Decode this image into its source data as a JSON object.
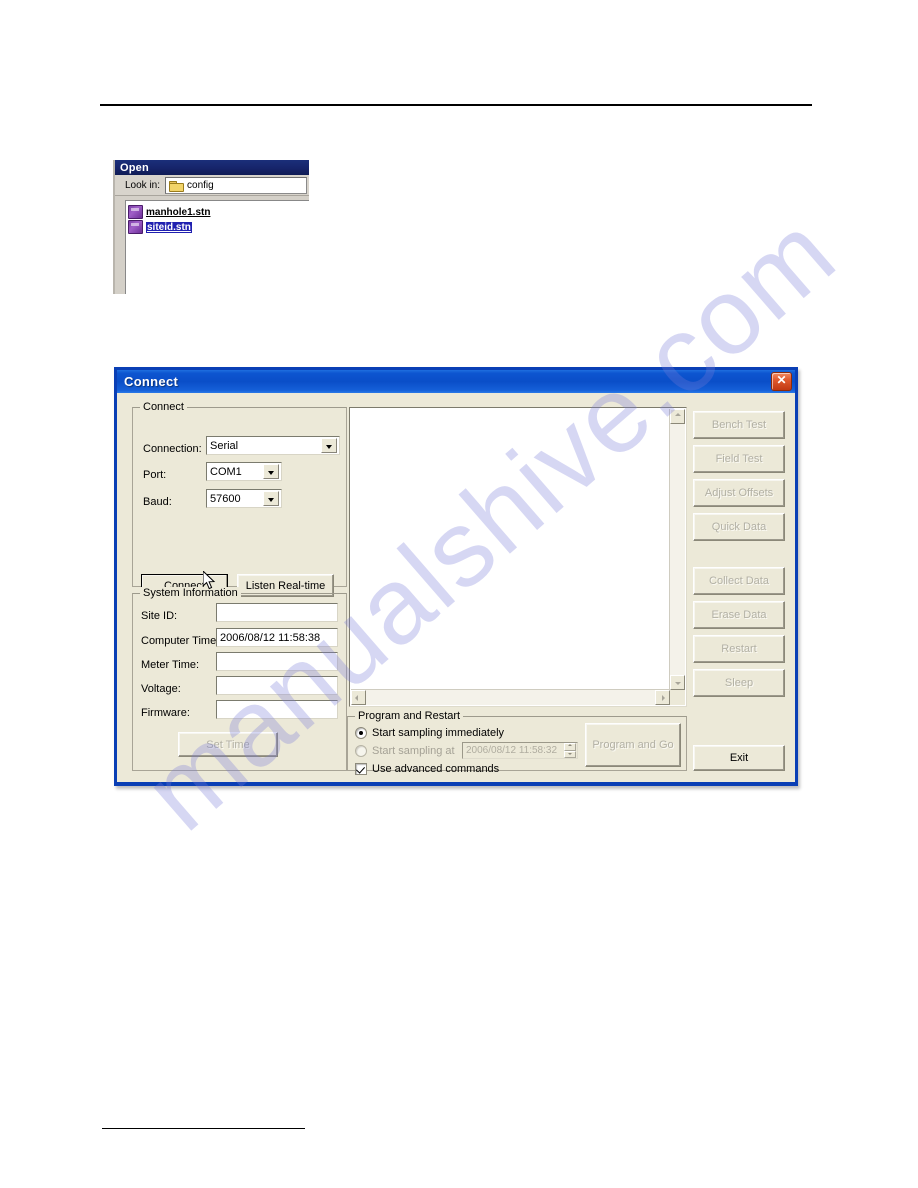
{
  "open_dialog": {
    "title": "Open",
    "lookin_label": "Look in:",
    "lookin_value": "config",
    "folder_icon": "folder-icon",
    "files": [
      {
        "name": "manhole1.stn",
        "icon": "station-file-icon",
        "selected": false
      },
      {
        "name": "siteid.stn",
        "icon": "station-file-icon",
        "selected": true
      }
    ]
  },
  "connect_dialog": {
    "title": "Connect",
    "close_icon": "close-icon",
    "connect_group": {
      "title": "Connect",
      "connection_label": "Connection:",
      "connection_value": "Serial",
      "port_label": "Port:",
      "port_value": "COM1",
      "baud_label": "Baud:",
      "baud_value": "57600",
      "connect_button": "Connect",
      "listen_button": "Listen Real-time"
    },
    "system_info_group": {
      "title": "System Information",
      "site_id_label": "Site ID:",
      "site_id_value": "",
      "computer_time_label": "Computer Time:",
      "computer_time_value": "2006/08/12 11:58:38",
      "meter_time_label": "Meter Time:",
      "meter_time_value": "",
      "voltage_label": "Voltage:",
      "voltage_value": "",
      "firmware_label": "Firmware:",
      "firmware_value": "",
      "set_time_button": "Set Time"
    },
    "output_pane": {
      "text": "",
      "vscroll_up_icon": "chevron-up-icon",
      "vscroll_down_icon": "chevron-down-icon",
      "hscroll_left_icon": "chevron-left-icon",
      "hscroll_right_icon": "chevron-right-icon"
    },
    "program_group": {
      "title": "Program and Restart",
      "radio_immediate_label": "Start sampling immediately",
      "radio_immediate_checked": true,
      "radio_at_label": "Start sampling at",
      "radio_at_checked": false,
      "scheduled_time_value": "2006/08/12  11:58:32",
      "spinner_icon": "spinner-arrows-icon",
      "checkbox_advanced_label": "Use advanced commands",
      "checkbox_advanced_checked": true,
      "program_and_go_button": "Program and Go"
    },
    "actions": [
      {
        "label": "Bench Test",
        "disabled": true
      },
      {
        "label": "Field Test",
        "disabled": true
      },
      {
        "label": "Adjust Offsets",
        "disabled": true
      },
      {
        "label": "Quick Data",
        "disabled": true
      },
      {
        "label": "Collect Data",
        "disabled": true
      },
      {
        "label": "Erase Data",
        "disabled": true
      },
      {
        "label": "Restart",
        "disabled": true
      },
      {
        "label": "Sleep",
        "disabled": true
      }
    ],
    "exit_button": "Exit"
  },
  "watermark": {
    "text": "manualshive.com",
    "color": "#787cd8"
  },
  "colors": {
    "dialog_face": "#ece9d8",
    "title_blue": "#0a4ec8",
    "open_title_navy": "#16246a",
    "close_red": "#c03812",
    "selection_blue": "#2020b0"
  }
}
